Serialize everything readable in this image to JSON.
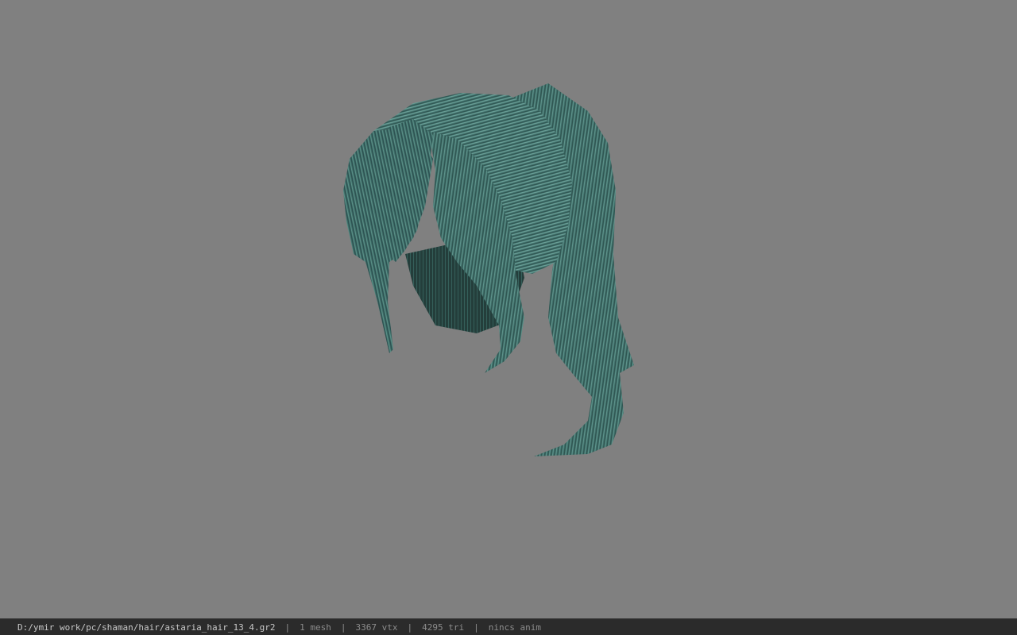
{
  "viewport": {
    "background_color": "#808080",
    "model": {
      "subject": "hair mesh",
      "color": "#3e6f69"
    }
  },
  "status_bar": {
    "file_path": "D:/ymir work/pc/shaman/hair/astaria_hair_13_4.gr2",
    "mesh_count": "1 mesh",
    "vertex_count": "3367 vtx",
    "triangle_count": "4295 tri",
    "anim": "nincs anim",
    "separator": "|"
  }
}
